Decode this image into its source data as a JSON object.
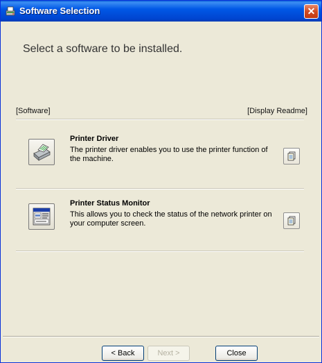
{
  "window": {
    "title": "Software Selection",
    "close_glyph": "✕"
  },
  "main": {
    "heading": "Select a software to be installed.",
    "column_left": "[Software]",
    "column_right": "[Display Readme]",
    "items": [
      {
        "name": "Printer Driver",
        "description": "The printer driver enables you to use the printer function of the machine.",
        "icon": "printer-icon"
      },
      {
        "name": "Printer Status Monitor",
        "description": "This allows you to check the status of the network printer on your computer screen.",
        "icon": "status-monitor-icon"
      }
    ]
  },
  "footer": {
    "back": "< Back",
    "next": "Next >",
    "close": "Close"
  },
  "colors": {
    "titlebar": "#0058e6",
    "window_bg": "#ece9d8",
    "close_button": "#d04a22"
  }
}
